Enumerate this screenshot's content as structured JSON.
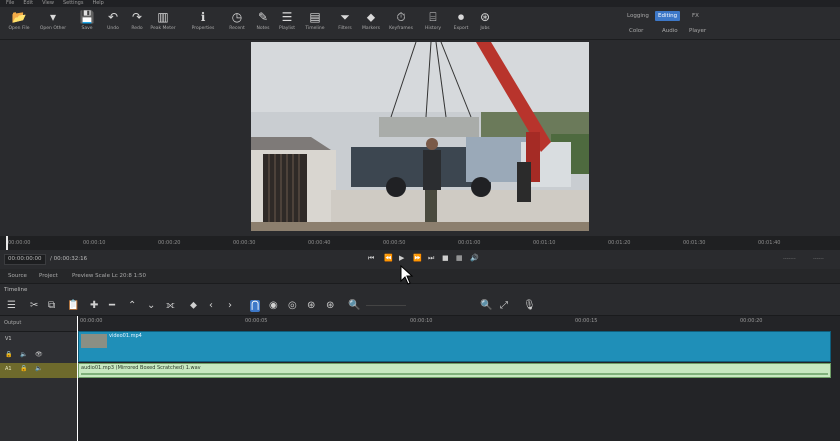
{
  "menu": [
    "File",
    "Edit",
    "View",
    "Settings",
    "Help"
  ],
  "toolbar": [
    {
      "icon": "open-file-icon",
      "glyph": "📂",
      "label": "Open File"
    },
    {
      "icon": "open-other-icon",
      "glyph": "▾",
      "label": "Open Other"
    },
    {
      "icon": "save-icon",
      "glyph": "💾",
      "label": "Save"
    },
    {
      "icon": "undo-icon",
      "glyph": "↶",
      "label": "Undo"
    },
    {
      "icon": "redo-icon",
      "glyph": "↷",
      "label": "Redo"
    },
    {
      "icon": "peak-meter-icon",
      "glyph": "▥",
      "label": "Peak Meter"
    },
    {
      "icon": "properties-icon",
      "glyph": "ℹ",
      "label": "Properties"
    },
    {
      "icon": "recent-icon",
      "glyph": "◷",
      "label": "Recent"
    },
    {
      "icon": "notes-icon",
      "glyph": "✎",
      "label": "Notes"
    },
    {
      "icon": "playlist-icon",
      "glyph": "☰",
      "label": "Playlist"
    },
    {
      "icon": "timeline-icon",
      "glyph": "▤",
      "label": "Timeline"
    },
    {
      "icon": "filters-icon",
      "glyph": "⏷",
      "label": "Filters"
    },
    {
      "icon": "markers-icon",
      "glyph": "⬥",
      "label": "Markers"
    },
    {
      "icon": "keyframes-icon",
      "glyph": "⏱",
      "label": "Keyframes"
    },
    {
      "icon": "history-icon",
      "glyph": "⌸",
      "label": "History"
    },
    {
      "icon": "export-icon",
      "glyph": "⏺",
      "label": "Export"
    },
    {
      "icon": "jobs-icon",
      "glyph": "⊛",
      "label": "Jobs"
    }
  ],
  "layouts_row1": [
    "Logging",
    "Editing",
    "FX"
  ],
  "layouts_row2": [
    "Color",
    "Audio",
    "Player"
  ],
  "active_layout": "Editing",
  "ruler_ticks": [
    "00:00:00",
    "00:00:10",
    "00:00:20",
    "00:00:30",
    "00:00:40",
    "00:00:50",
    "00:01:00",
    "00:01:10",
    "00:01:20",
    "00:01:30",
    "00:01:40"
  ],
  "transport": {
    "position": "00:00:00:00",
    "duration": "/ 00:00:32:16",
    "zoom": "-------",
    "volume": "------"
  },
  "tabs": [
    "Source",
    "Project",
    "Preview Scale Lc 20:8 1:50"
  ],
  "timeline": {
    "title": "Timeline",
    "ruler": [
      "00:00:00",
      "00:00:05",
      "00:00:10",
      "00:00:15",
      "00:00:20"
    ],
    "tracks": [
      {
        "name": "Output"
      },
      {
        "name": "V1",
        "clip": "video01.mp4"
      },
      {
        "name": "A1",
        "clip": "audio01.mp3 (Mirrored Boxed Scratched) 1.wav"
      }
    ]
  },
  "colors": {
    "accent": "#3d78c8",
    "video_clip": "#1f8fb8",
    "audio_clip": "#c7e8c0",
    "audio_header": "#6e6a2c"
  }
}
